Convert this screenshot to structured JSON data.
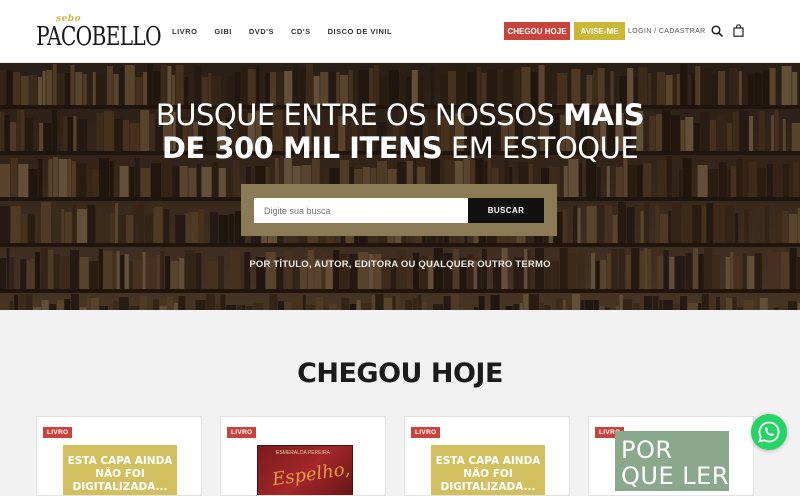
{
  "header": {
    "logo_small": "sebo",
    "logo_name": "PACOBELLO",
    "nav": [
      "LIVRO",
      "GIBI",
      "DVD'S",
      "CD'S",
      "DISCO DE VINIL"
    ],
    "chegou_label": "CHEGOU HOJE",
    "avise_label": "AVISE-ME",
    "login_label": "LOGIN / CADASTRAR",
    "search_icon": "search-icon",
    "bag_icon": "shopping-bag-icon"
  },
  "hero": {
    "title_line1_normal": "BUSQUE ENTRE OS NOSSOS ",
    "title_line1_bold": "MAIS",
    "title_line2_bold": "DE 300 MIL ITENS",
    "title_line2_normal": " EM ESTOQUE",
    "search_placeholder": "Digite sua busca",
    "search_button": "BUSCAR",
    "subtitle": "POR TÍTULO, AUTOR, EDITORA OU QUALQUER OUTRO TERMO"
  },
  "section": {
    "title": "CHEGOU HOJE"
  },
  "products": [
    {
      "badge": "LIVRO",
      "cover_text": "ESTA CAPA AINDA NÃO FOI DIGITALIZADA..."
    },
    {
      "badge": "LIVRO",
      "cover_small": "ESMERALDA PEREIRA",
      "cover_script": "Espelho,"
    },
    {
      "badge": "LIVRO",
      "cover_text": "ESTA CAPA AINDA NÃO FOI DIGITALIZADA..."
    },
    {
      "badge": "LIVRO",
      "cover_text": "POR QUE LER"
    }
  ],
  "colors": {
    "red": "#c9433d",
    "mustard": "#c9b735",
    "whatsapp": "#25d366"
  },
  "whatsapp_icon": "whatsapp-icon"
}
